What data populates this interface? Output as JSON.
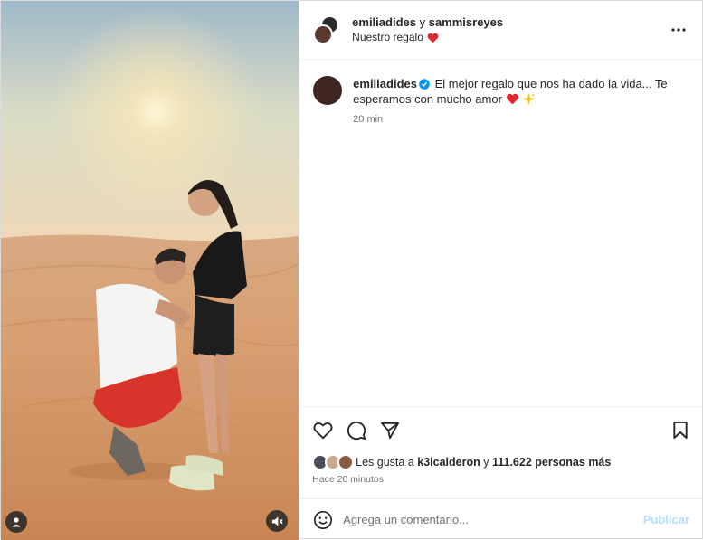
{
  "header": {
    "user1": "emiliadides",
    "joiner": "y",
    "user2": "sammisreyes",
    "subtitle": "Nuestro regalo",
    "subtitle_emoji": "heart-emoji"
  },
  "caption": {
    "username": "emiliadides",
    "text": "El mejor regalo que nos ha dado la vida... Te esperamos con mucho amor",
    "emojis": [
      "heart-emoji",
      "sparkle-emoji"
    ],
    "time": "20 min"
  },
  "likes": {
    "prefix": "Les gusta a",
    "user": "k3lcalderon",
    "joiner": "y",
    "rest": "111.622 personas más"
  },
  "post_time": "Hace 20 minutos",
  "comment_box": {
    "placeholder": "Agrega un comentario...",
    "publish_label": "Publicar"
  },
  "colors": {
    "heart": "#e0292c",
    "verified": "#0095f6",
    "publish_disabled": "#b2dffc",
    "secondary_text": "#737373"
  },
  "icons": [
    "tag-user-icon",
    "mute-icon",
    "more-icon",
    "like-icon",
    "comment-icon",
    "share-icon",
    "save-icon",
    "emoji-icon",
    "verified-icon"
  ]
}
